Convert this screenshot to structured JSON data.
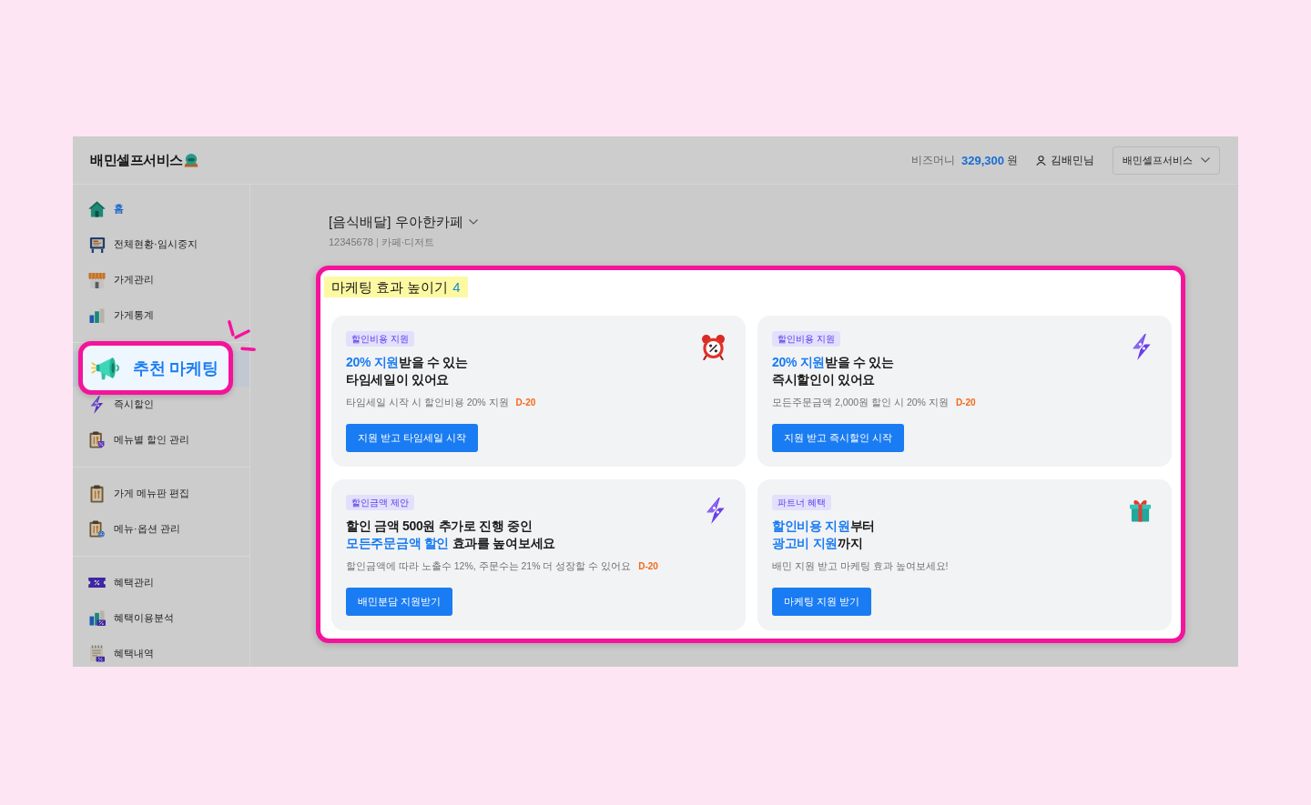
{
  "header": {
    "logo": "배민셀프서비스",
    "bizmoney": {
      "label": "비즈머니",
      "amount": "329,300",
      "unit": "원"
    },
    "user": "김배민님",
    "service_select": {
      "value": "배민셀프서비스"
    }
  },
  "sidebar": {
    "groups": [
      {
        "items": [
          {
            "label": "홈",
            "kind": "home",
            "selected": false
          },
          {
            "label": "전체현황·임시중지",
            "kind": "link",
            "selected": false
          },
          {
            "label": "가게관리",
            "kind": "link",
            "selected": false
          },
          {
            "label": "가게통계",
            "kind": "link",
            "selected": false
          }
        ]
      },
      {
        "items": [
          {
            "label": "추천 마케팅",
            "kind": "link",
            "selected": true
          },
          {
            "label": "즉시할인",
            "kind": "link",
            "selected": false
          },
          {
            "label": "메뉴별 할인 관리",
            "kind": "link",
            "selected": false
          }
        ]
      },
      {
        "items": [
          {
            "label": "가게 메뉴판 편집",
            "kind": "link",
            "selected": false
          },
          {
            "label": "메뉴·옵션 관리",
            "kind": "link",
            "selected": false
          }
        ]
      },
      {
        "items": [
          {
            "label": "혜택관리",
            "kind": "link",
            "selected": false
          },
          {
            "label": "혜택이용분석",
            "kind": "link",
            "selected": false
          },
          {
            "label": "혜택내역",
            "kind": "link",
            "selected": false
          }
        ]
      }
    ]
  },
  "store": {
    "name": "[음식배달] 우아한카페",
    "id": "12345678",
    "separator": "|",
    "category": "카페·디저트"
  },
  "marketing": {
    "highlighted": true,
    "title": "마케팅 효과 높이기",
    "count": "4",
    "cards": [
      {
        "tag": "할인비용 지원",
        "title_lines": [
          [
            {
              "text": "20% 지원",
              "accent": true
            },
            {
              "text": "받을 수 있는",
              "accent": false
            }
          ],
          [
            {
              "text": "타임세일이 있어요",
              "accent": false
            }
          ]
        ],
        "description": "타임세일 시작 시 할인비용 20% 지원",
        "deadline": "D-20",
        "button": "지원 받고 타임세일 시작"
      },
      {
        "tag": "할인비용 지원",
        "title_lines": [
          [
            {
              "text": "20% 지원",
              "accent": true
            },
            {
              "text": "받을 수 있는",
              "accent": false
            }
          ],
          [
            {
              "text": "즉시할인이 있어요",
              "accent": false
            }
          ]
        ],
        "description": "모든주문금액 2,000원 할인 시 20% 지원",
        "deadline": "D-20",
        "button": "지원 받고 즉시할인 시작"
      },
      {
        "tag": "할인금액 제안",
        "title_lines": [
          [
            {
              "text": "할인 금액 500원 추가로 진행 중인",
              "accent": false
            }
          ],
          [
            {
              "text": "모든주문금액 할인",
              "accent": true
            },
            {
              "text": " 효과를 높여보세요",
              "accent": false
            }
          ]
        ],
        "description": "할인금액에 따라 노출수 12%, 주문수는 21% 더 성장할 수 있어요",
        "deadline": "D-20",
        "button": "배민분담 지원받기"
      },
      {
        "tag": "파트너 혜택",
        "title_lines": [
          [
            {
              "text": "할인비용 지원",
              "accent": true
            },
            {
              "text": "부터",
              "accent": false
            }
          ],
          [
            {
              "text": "광고비 지원",
              "accent": true
            },
            {
              "text": "까지",
              "accent": false
            }
          ]
        ],
        "description": "배민 지원 받고 마케팅 효과 높여보세요!",
        "button": "마케팅 지원 받기"
      }
    ]
  }
}
